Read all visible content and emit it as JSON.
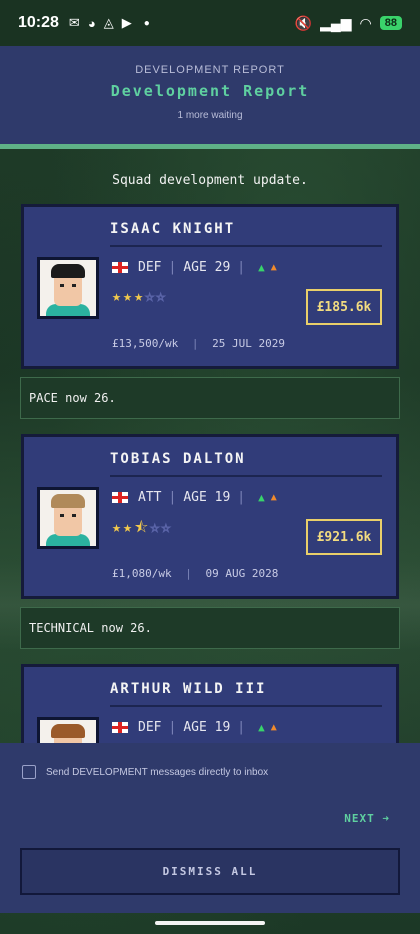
{
  "status_bar": {
    "time": "10:28",
    "battery": "88"
  },
  "header": {
    "kicker": "DEVELOPMENT REPORT",
    "title": "Development Report",
    "subtitle": "1 more waiting"
  },
  "intro": "Squad development update.",
  "players": [
    {
      "name": "ISAAC KNIGHT",
      "position": "DEF",
      "age": "AGE 29",
      "rating": 3,
      "value": "£185.6k",
      "wage": "£13,500/wk",
      "contract_end": "25 JUL 2029",
      "hair_color": "#1b1b1b",
      "note": "PACE now 26."
    },
    {
      "name": "TOBIAS DALTON",
      "position": "ATT",
      "age": "AGE 19",
      "rating": 2.5,
      "value": "£921.6k",
      "wage": "£1,080/wk",
      "contract_end": "09 AUG 2028",
      "hair_color": "#b08a5a",
      "note": "TECHNICAL now 26."
    },
    {
      "name": "ARTHUR WILD III",
      "position": "DEF",
      "age": "AGE 19",
      "hair_color": "#9a5a2a"
    }
  ],
  "footer": {
    "inbox_option": "Send DEVELOPMENT messages directly to inbox",
    "inbox_checked": false,
    "next_label": "NEXT ➜",
    "dismiss_label": "DISMISS ALL"
  },
  "colors": {
    "accent": "#5fd0a0",
    "value_gold": "#e9cf6a",
    "card_bg": "#313c79"
  }
}
